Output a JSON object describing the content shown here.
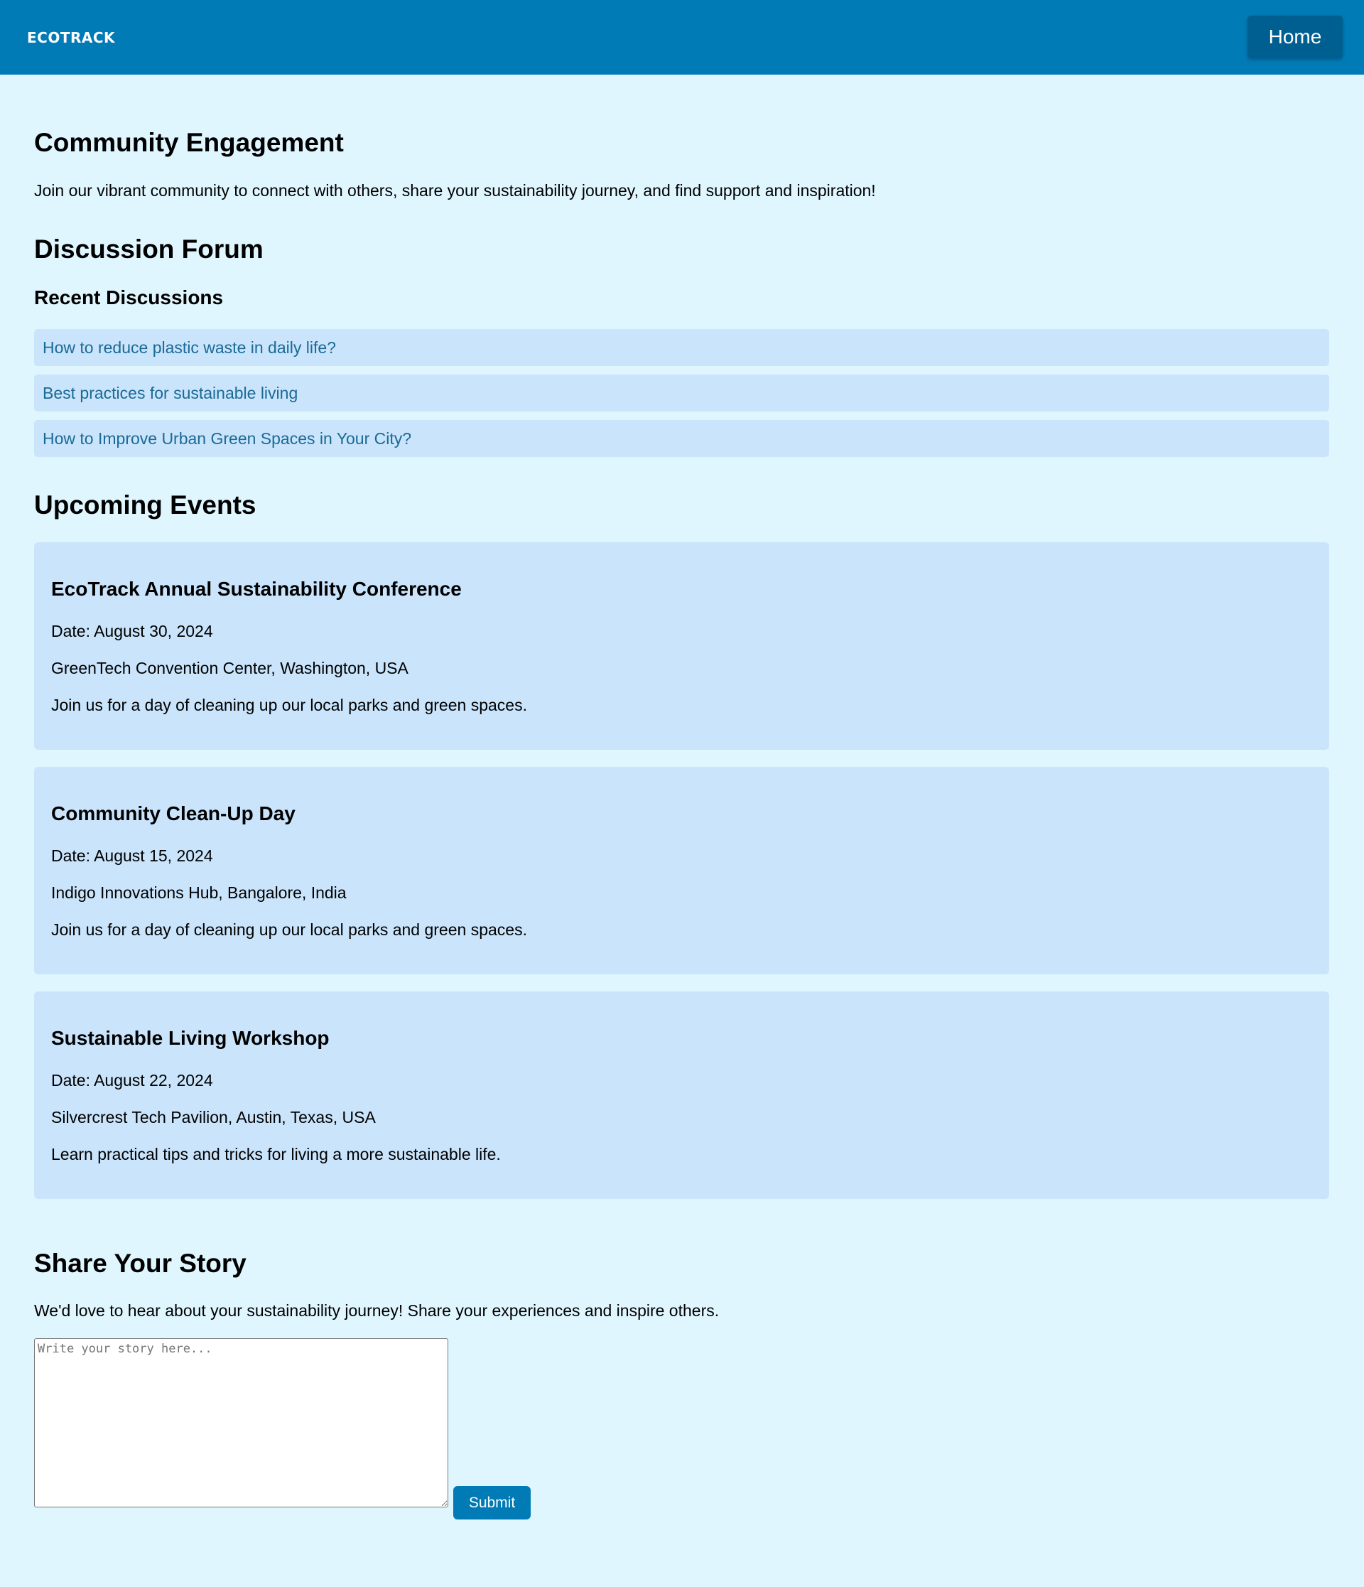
{
  "header": {
    "logo": "ECOTRACK",
    "home_label": "Home"
  },
  "community": {
    "title": "Community Engagement",
    "intro": "Join our vibrant community to connect with others, share your sustainability journey, and find support and inspiration!"
  },
  "forum": {
    "title": "Discussion Forum",
    "subtitle": "Recent Discussions",
    "discussions": [
      "How to reduce plastic waste in daily life?",
      "Best practices for sustainable living",
      "How to Improve Urban Green Spaces in Your City?"
    ]
  },
  "events": {
    "title": "Upcoming Events",
    "items": [
      {
        "name": "EcoTrack Annual Sustainability Conference",
        "date": "Date: August 30, 2024",
        "location": "GreenTech Convention Center, Washington, USA",
        "description": "Join us for a day of cleaning up our local parks and green spaces."
      },
      {
        "name": "Community Clean-Up Day",
        "date": "Date: August 15, 2024",
        "location": "Indigo Innovations Hub, Bangalore, India",
        "description": "Join us for a day of cleaning up our local parks and green spaces."
      },
      {
        "name": "Sustainable Living Workshop",
        "date": "Date: August 22, 2024",
        "location": "Silvercrest Tech Pavilion, Austin, Texas, USA",
        "description": "Learn practical tips and tricks for living a more sustainable life."
      }
    ]
  },
  "story": {
    "title": "Share Your Story",
    "intro": "We'd love to hear about your sustainability journey! Share your experiences and inspire others.",
    "placeholder": "Write your story here...",
    "value": "",
    "submit_label": "Submit"
  },
  "colors": {
    "header_bg": "#007bb6",
    "home_button_bg": "#005f91",
    "page_bg": "#e0f6ff",
    "card_bg": "#c9e4fb",
    "link_text": "#1b6a96",
    "submit_bg": "#007bb6"
  }
}
